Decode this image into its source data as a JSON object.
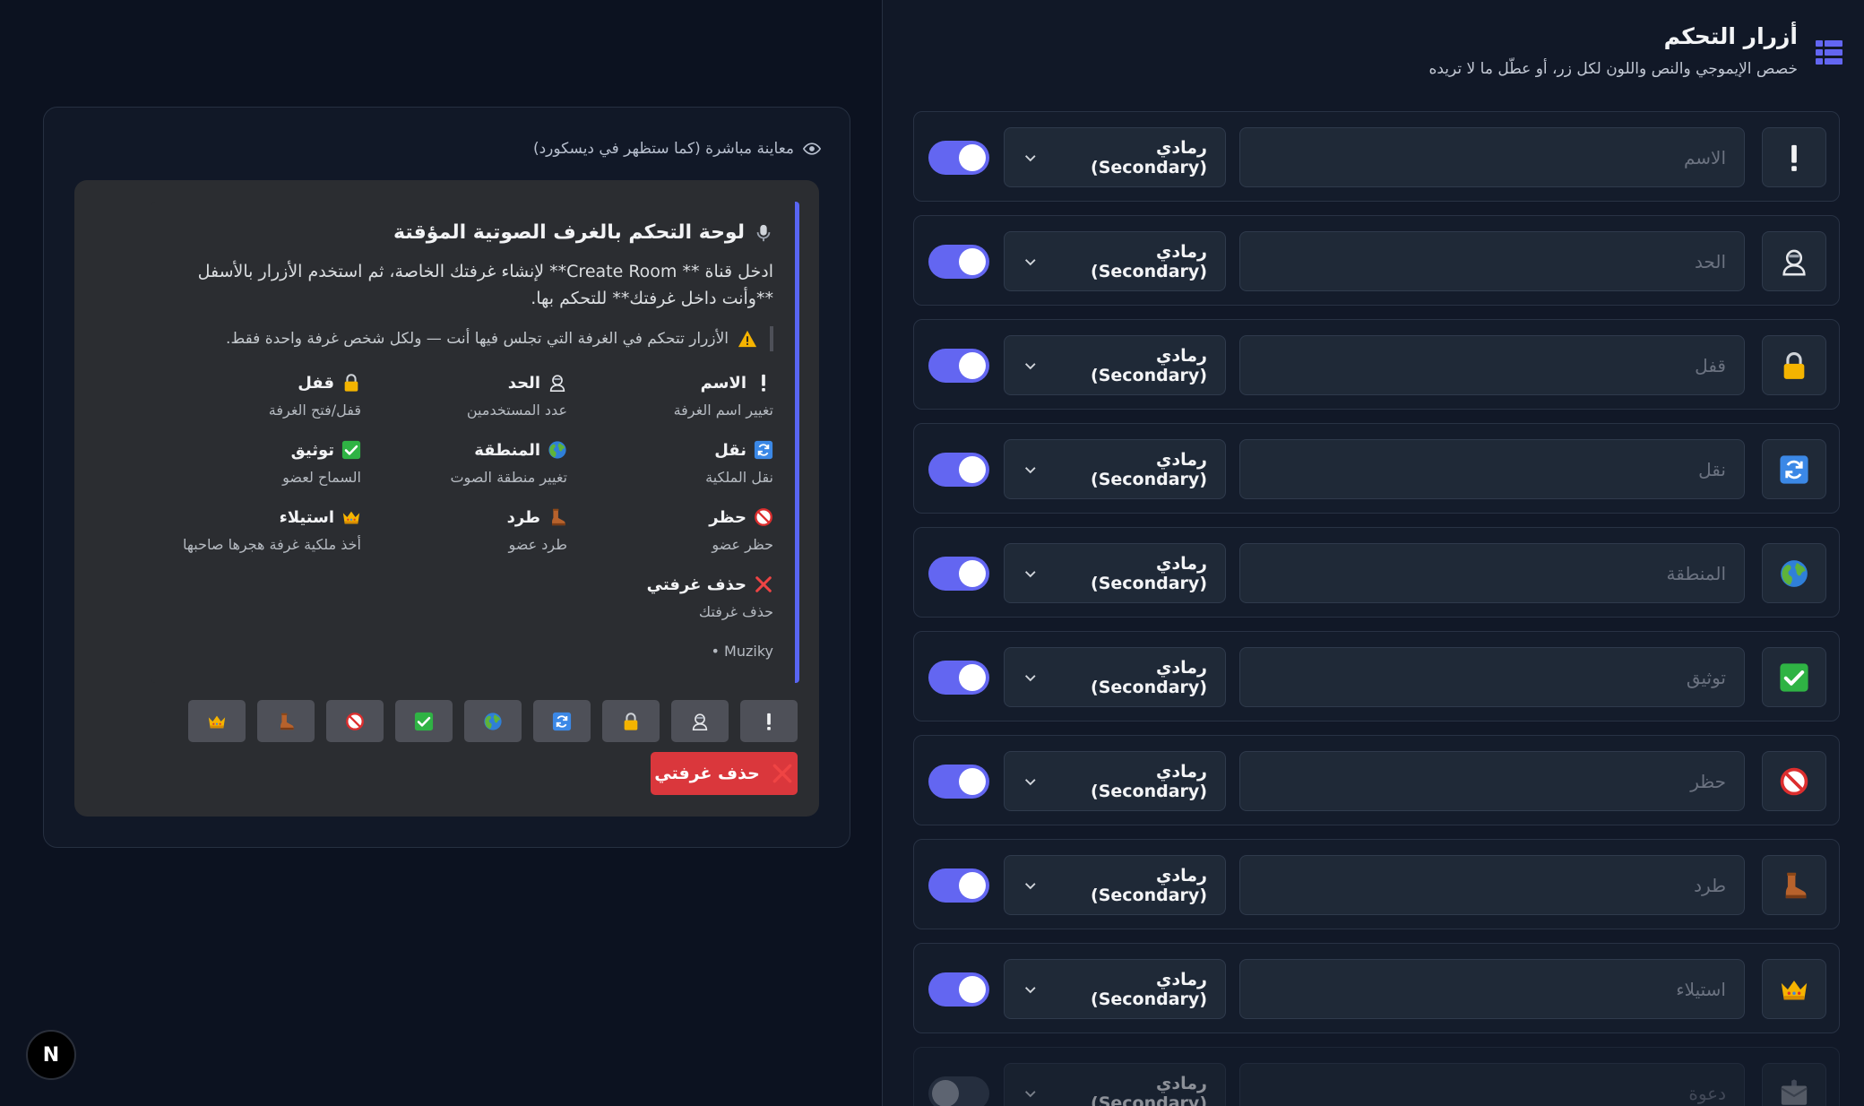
{
  "preview": {
    "label": "معاينة مباشرة (كما ستظهر في ديسكورد)",
    "embed": {
      "title": "لوحة التحكم بالغرف الصوتية المؤقتة",
      "description": "ادخل قناة ** Create Room** لإنشاء غرفتك الخاصة، ثم استخدم الأزرار بالأسفل **وأنت داخل غرفتك** للتحكم بها.",
      "quote": "الأزرار تتحكم في الغرفة التي تجلس فيها أنت — ولكل شخص غرفة واحدة فقط.",
      "fields": [
        {
          "icon": "exclamation-icon",
          "name": "الاسم",
          "value": "تغيير اسم الغرفة"
        },
        {
          "icon": "user-limit-icon",
          "name": "الحد",
          "value": "عدد المستخدمين"
        },
        {
          "icon": "lock-icon",
          "name": "قفل",
          "value": "قفل/فتح الغرفة"
        },
        {
          "icon": "transfer-icon",
          "name": "نقل",
          "value": "نقل الملكية"
        },
        {
          "icon": "globe-icon",
          "name": "المنطقة",
          "value": "تغيير منطقة الصوت"
        },
        {
          "icon": "check-icon",
          "name": "توثيق",
          "value": "السماح لعضو"
        },
        {
          "icon": "ban-icon",
          "name": "حظر",
          "value": "حظر عضو"
        },
        {
          "icon": "boot-icon",
          "name": "طرد",
          "value": "طرد عضو"
        },
        {
          "icon": "crown-icon",
          "name": "استيلاء",
          "value": "أخذ ملكية غرفة هجرها صاحبها"
        },
        {
          "icon": "x-icon",
          "name": "حذف غرفتي",
          "value": "حذف غرفتك"
        }
      ],
      "footer": "• Muziky"
    },
    "delete_button": "حذف غرفتي"
  },
  "badge": "N",
  "controls": {
    "title": "أزرار التحكم",
    "subtitle": "خصص الإيموجي والنص واللون لكل زر، أو عطّل ما لا تريده",
    "rows": [
      {
        "icon": "exclamation-icon",
        "placeholder": "الاسم",
        "style": "رمادي (Secondary)",
        "enabled": true
      },
      {
        "icon": "user-limit-icon",
        "placeholder": "الحد",
        "style": "رمادي (Secondary)",
        "enabled": true
      },
      {
        "icon": "lock-icon",
        "placeholder": "قفل",
        "style": "رمادي (Secondary)",
        "enabled": true
      },
      {
        "icon": "transfer-icon",
        "placeholder": "نقل",
        "style": "رمادي (Secondary)",
        "enabled": true
      },
      {
        "icon": "globe-icon",
        "placeholder": "المنطقة",
        "style": "رمادي (Secondary)",
        "enabled": true
      },
      {
        "icon": "check-icon",
        "placeholder": "توثيق",
        "style": "رمادي (Secondary)",
        "enabled": true
      },
      {
        "icon": "ban-icon",
        "placeholder": "حظر",
        "style": "رمادي (Secondary)",
        "enabled": true
      },
      {
        "icon": "boot-icon",
        "placeholder": "طرد",
        "style": "رمادي (Secondary)",
        "enabled": true
      },
      {
        "icon": "crown-icon",
        "placeholder": "استيلاء",
        "style": "رمادي (Secondary)",
        "enabled": true
      },
      {
        "icon": "envelope-icon",
        "placeholder": "دعوة",
        "style": "رمادي (Secondary)",
        "enabled": false
      }
    ]
  },
  "colors": {
    "accent": "#6366f1",
    "discord_blurple": "#5865f2",
    "danger": "#da373c"
  }
}
